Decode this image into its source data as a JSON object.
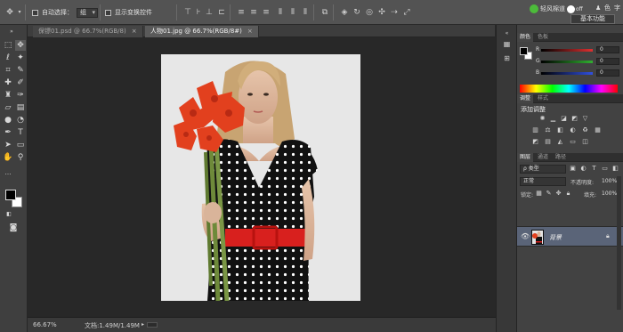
{
  "options_bar": {
    "auto_select_label": "自动选择：",
    "auto_select_value": "组",
    "show_transform_label": "显示变换控件",
    "cloud_label": "轻风棉道",
    "toggle_label": "off",
    "workspace_button": "基本功能",
    "top_right_icons": [
      "色",
      "字"
    ]
  },
  "tabs": [
    {
      "label": "保镖01.psd @ 66.7%(RGB/8)",
      "close": "×"
    },
    {
      "label": "人物01.jpg @ 66.7%(RGB/8#)",
      "close": "×"
    }
  ],
  "status": {
    "zoom": "66.67%",
    "doc_size": "文档:1.49M/1.49M"
  },
  "color_panel": {
    "tabs": [
      "颜色",
      "色板"
    ],
    "rows": [
      {
        "label": "R",
        "value": "0",
        "color": "#e03030"
      },
      {
        "label": "G",
        "value": "0",
        "color": "#30b030"
      },
      {
        "label": "B",
        "value": "0",
        "color": "#3050e0"
      }
    ]
  },
  "adjust_panel": {
    "tabs": [
      "调整",
      "样式"
    ],
    "title": "添加调整"
  },
  "layers_panel": {
    "tabs": [
      "图层",
      "通道",
      "路径"
    ],
    "filter_label": "ρ 类型",
    "blend_mode": "正常",
    "opacity_label": "不透明度:",
    "opacity_value": "100%",
    "lock_label": "锁定:",
    "fill_label": "填充:",
    "fill_value": "100%",
    "layer_name": "背景"
  },
  "colors": {
    "foreground": "#000000",
    "background": "#ffffff",
    "dress": "#101010",
    "belt": "#d8201e",
    "flower": "#e2401e",
    "stem": "#6e8a3a",
    "skin": "#d9b49a",
    "hair": "#c9a676"
  }
}
